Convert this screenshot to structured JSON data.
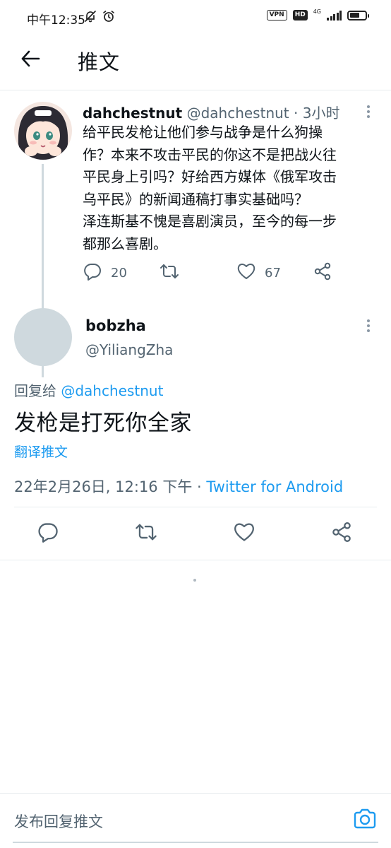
{
  "status_bar": {
    "time": "中午12:35",
    "vpn_badge": "VPN",
    "hd_badge": "HD",
    "network": "4G",
    "icons": [
      "mute-bell-icon",
      "alarm-icon",
      "signal-icon",
      "battery-icon"
    ]
  },
  "header": {
    "title": "推文",
    "back_icon": "arrow-left-icon"
  },
  "parent_tweet": {
    "display_name": "dahchestnut",
    "handle": "@dahchestnut",
    "separator": " · ",
    "time": "3小时",
    "lines": [
      "给平民发枪让他们参与战争是什么狗操",
      "作？本来不攻击平民的你这不是把战火往",
      "平民身上引吗？好给西方媒体《俄军攻击",
      "乌平民》的新闻通稿打事实基础吗？",
      "泽连斯基不愧是喜剧演员，至今的每一步",
      "都那么喜剧。"
    ],
    "reply_count": "20",
    "like_count": "67"
  },
  "focused_tweet": {
    "display_name": "bobzha",
    "handle": "@YiliangZha",
    "reply_label": "回复给 ",
    "reply_mention": "@dahchestnut",
    "text": "发枪是打死你全家",
    "translate_label": "翻译推文",
    "timestamp": "22年2月26日, 12:16 下午",
    "separator": " · ",
    "source": "Twitter for Android"
  },
  "compose": {
    "placeholder": "发布回复推文",
    "camera_icon": "camera-icon"
  },
  "colors": {
    "accent": "#1d9bf0",
    "text_primary": "#0f1419",
    "text_secondary": "#536471",
    "divider": "#e8ecef",
    "avatar_placeholder": "#cfd9de"
  }
}
